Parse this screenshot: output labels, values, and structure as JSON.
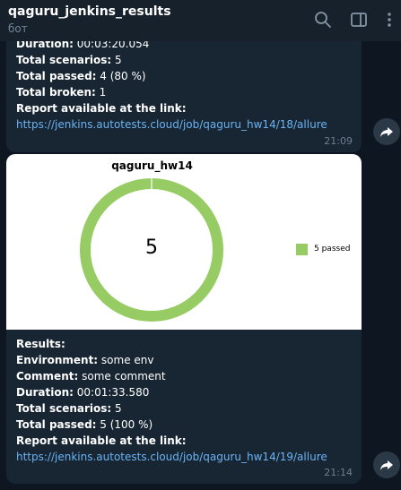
{
  "header": {
    "title": "qaguru_jenkins_results",
    "subtitle": "бот",
    "icons": [
      "search-icon",
      "sidebar-panel-icon",
      "more-icon"
    ]
  },
  "message1": {
    "partial_top": {
      "label": "Duration:",
      "value": " 00:03:20.054"
    },
    "rows": [
      {
        "label": "Total scenarios:",
        "value": " 5"
      },
      {
        "label": "Total passed:",
        "value": " 4 (80 %)"
      },
      {
        "label": "Total broken:",
        "value": " 1"
      },
      {
        "label": "Report available at the link:",
        "value": ""
      }
    ],
    "link": "https://jenkins.autotests.cloud/job/qaguru_hw14/18/allure",
    "time": "21:09"
  },
  "message2": {
    "chart_data": {
      "type": "pie",
      "title": "qaguru_hw14",
      "center_label": "5",
      "slices": [
        {
          "name": "5 passed",
          "value": 5,
          "color": "#97cc64"
        }
      ],
      "legend": [
        "5 passed"
      ],
      "legend_position": "right"
    },
    "rows": [
      {
        "label": "Results:",
        "value": ""
      },
      {
        "label": "Environment:",
        "value": " some env"
      },
      {
        "label": "Comment:",
        "value": " some comment"
      },
      {
        "label": "Duration:",
        "value": " 00:01:33.580"
      },
      {
        "label": "Total scenarios:",
        "value": " 5"
      },
      {
        "label": "Total passed:",
        "value": " 5 (100 %)"
      },
      {
        "label": "Report available at the link:",
        "value": ""
      }
    ],
    "link": "https://jenkins.autotests.cloud/job/qaguru_hw14/19/allure",
    "time": "21:14"
  },
  "colors": {
    "background": "#0e1621",
    "header": "#17212b",
    "bubble": "#182533",
    "link": "#6ab3f3",
    "passed": "#97cc64"
  }
}
